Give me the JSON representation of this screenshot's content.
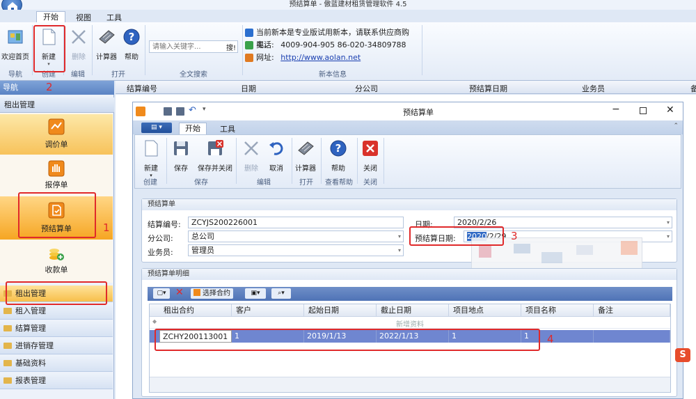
{
  "app": {
    "title": "预结算单 - 傲蓝建材租赁管理软件 4.5"
  },
  "ribbon": {
    "tabs": [
      "开始",
      "视图",
      "工具"
    ],
    "buttons": {
      "welcome": "欢迎首页",
      "new": "新建",
      "delete": "删除",
      "calculator": "计算器",
      "help": "帮助"
    },
    "search_placeholder": "请输入关键字...",
    "search_button": "搜!",
    "groups": {
      "nav": "导航",
      "create": "创建",
      "edit": "编辑",
      "open": "打开",
      "search": "全文搜索",
      "info": "新本信息"
    },
    "info": {
      "line1": "当前新本是专业版试用新本，请联系供应商购买。",
      "phone_label": "电话:",
      "phone": "4009-904-905  86-020-34809788",
      "web_label": "网址:",
      "web": "http://www.aolan.net"
    }
  },
  "nav": {
    "header": "导航",
    "section": "租出管理",
    "items": [
      "调价单",
      "报停单",
      "预结算单",
      "收款单"
    ],
    "folders": [
      "租出管理",
      "租入管理",
      "结算管理",
      "进销存管理",
      "基础资料",
      "报表管理"
    ]
  },
  "list_columns": [
    "结算编号",
    "日期",
    "分公司",
    "预结算日期",
    "业务员",
    "备"
  ],
  "dialog": {
    "title": "预结算单",
    "tabs": [
      "开始",
      "工具"
    ],
    "buttons": {
      "new": "新建",
      "save": "保存",
      "save_close": "保存并关闭",
      "delete": "删除",
      "cancel": "取消",
      "calculator": "计算器",
      "help": "帮助",
      "close": "关闭"
    },
    "groups": {
      "create": "创建",
      "save": "保存",
      "edit": "编辑",
      "open": "打开",
      "help": "查看帮助",
      "close": "关闭"
    },
    "form": {
      "section": "预结算单",
      "code_label": "结算编号:",
      "code": "ZCYJS200226001",
      "date_label": "日期:",
      "date": "2020/2/26",
      "branch_label": "分公司:",
      "branch": "总公司",
      "presettle_label": "预结算日期:",
      "presettle_sel": "2020",
      "presettle_rest": "/2/29",
      "staff_label": "业务员:",
      "staff": "管理员"
    },
    "detail": {
      "section": "预结算单明细",
      "select_contract": "选择合约",
      "columns": [
        "租出合约",
        "客户",
        "起始日期",
        "截止日期",
        "项目地点",
        "项目名称",
        "备注"
      ],
      "new_row": "新增资料",
      "rows": [
        [
          "ZCHY200113001",
          "1",
          "2019/1/13",
          "2022/1/13",
          "1",
          "1",
          ""
        ]
      ]
    }
  },
  "annotations": [
    "1",
    "2",
    "3",
    "4"
  ],
  "colors": {
    "accent": "#f6a623",
    "red": "#e0292a",
    "selected": "#6f86d0"
  }
}
